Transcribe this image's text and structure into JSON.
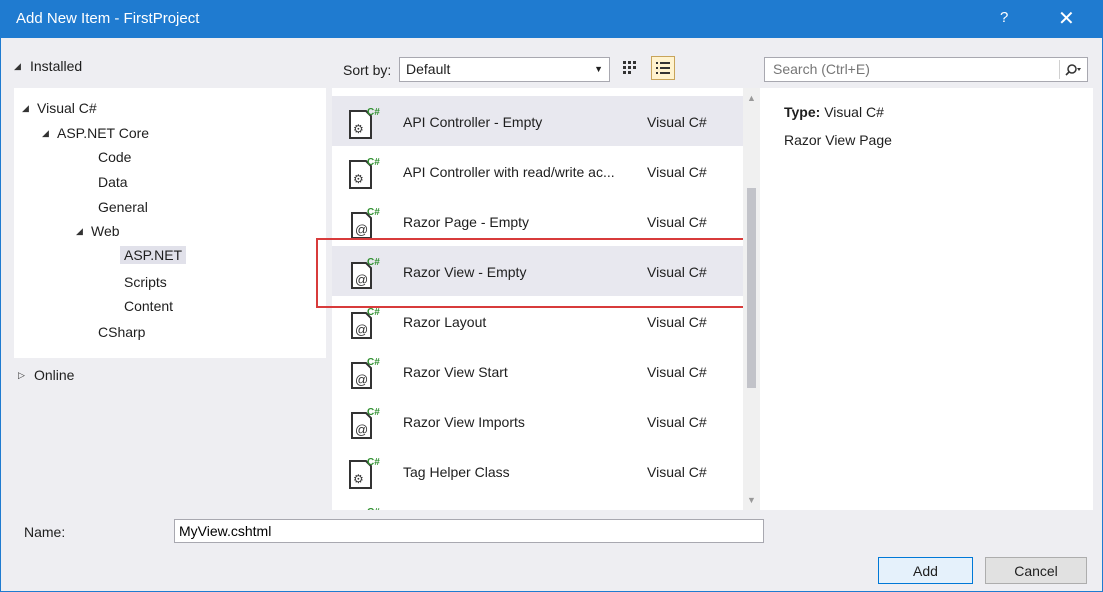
{
  "window": {
    "title": "Add New Item - FirstProject",
    "help_label": "?",
    "close_label": "✕"
  },
  "left": {
    "installed_label": "Installed",
    "tree": [
      {
        "label": "Visual C#"
      },
      {
        "label": "ASP.NET Core"
      },
      {
        "label": "Code"
      },
      {
        "label": "Data"
      },
      {
        "label": "General"
      },
      {
        "label": "Web"
      },
      {
        "label": "ASP.NET"
      },
      {
        "label": "Scripts"
      },
      {
        "label": "Content"
      },
      {
        "label": "CSharp"
      }
    ],
    "online_label": "Online"
  },
  "toolbar": {
    "sort_label": "Sort by:",
    "sort_value": "Default",
    "search_placeholder": "Search (Ctrl+E)"
  },
  "items": [
    {
      "name": "API Controller - Empty",
      "lang": "Visual C#",
      "icon": "class-icon"
    },
    {
      "name": "API Controller with read/write ac...",
      "lang": "Visual C#",
      "icon": "class-icon"
    },
    {
      "name": "Razor Page - Empty",
      "lang": "Visual C#",
      "icon": "razor-icon"
    },
    {
      "name": "Razor View - Empty",
      "lang": "Visual C#",
      "icon": "razor-icon"
    },
    {
      "name": "Razor Layout",
      "lang": "Visual C#",
      "icon": "razor-icon"
    },
    {
      "name": "Razor View Start",
      "lang": "Visual C#",
      "icon": "razor-icon"
    },
    {
      "name": "Razor View Imports",
      "lang": "Visual C#",
      "icon": "razor-icon"
    },
    {
      "name": "Tag Helper Class",
      "lang": "Visual C#",
      "icon": "class-icon"
    }
  ],
  "info": {
    "type_label": "Type:",
    "type_value": "Visual C#",
    "description": "Razor View Page"
  },
  "bottom": {
    "name_label": "Name:",
    "name_value": "MyView.cshtml",
    "add_label": "Add",
    "cancel_label": "Cancel"
  },
  "colors": {
    "titlebar": "#1f7bd0",
    "frame": "#eeeef2",
    "highlight_box": "#d83b3b",
    "csharp_green": "#2f8f2f"
  }
}
